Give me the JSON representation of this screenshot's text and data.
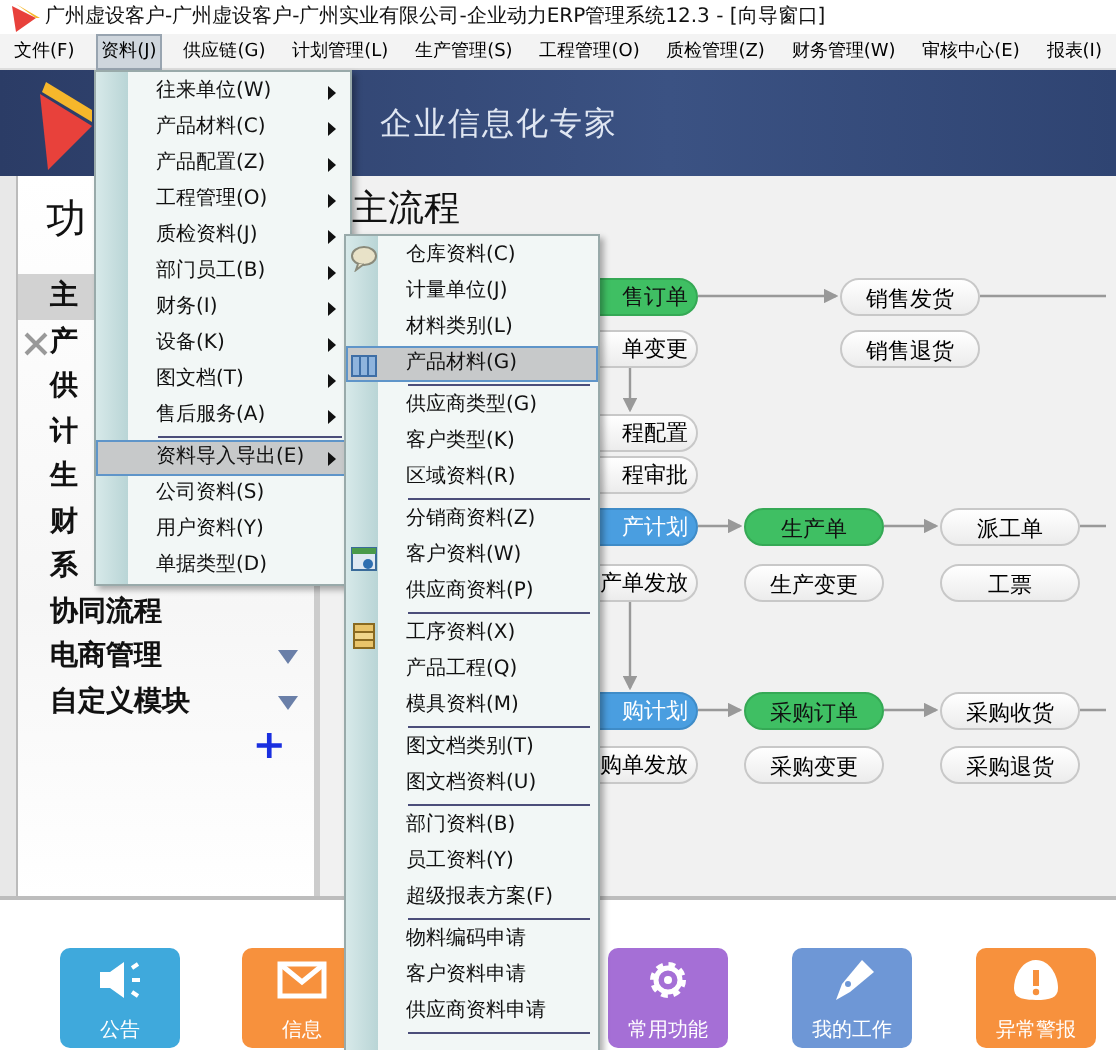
{
  "window": {
    "title": "广州虚设客户-广州虚设客户-广州实业有限公司-企业动力ERP管理系统12.3 - [向导窗口]"
  },
  "menu_bar": [
    {
      "label": "文件(F)",
      "selected": false
    },
    {
      "label": "资料(J)",
      "selected": true
    },
    {
      "label": "供应链(G)",
      "selected": false
    },
    {
      "label": "计划管理(L)",
      "selected": false
    },
    {
      "label": "生产管理(S)",
      "selected": false
    },
    {
      "label": "工程管理(O)",
      "selected": false
    },
    {
      "label": "质检管理(Z)",
      "selected": false
    },
    {
      "label": "财务管理(W)",
      "selected": false
    },
    {
      "label": "审核中心(E)",
      "selected": false
    },
    {
      "label": "报表(I)",
      "selected": false
    }
  ],
  "banner": {
    "slogan": "企业信息化专家"
  },
  "sidebar": {
    "title": "功",
    "items": [
      {
        "label": "主",
        "selected": true,
        "dropdown": false
      },
      {
        "label": "产",
        "selected": false,
        "dropdown": false
      },
      {
        "label": "供",
        "selected": false,
        "dropdown": false
      },
      {
        "label": "计",
        "selected": false,
        "dropdown": false
      },
      {
        "label": "生",
        "selected": false,
        "dropdown": false
      },
      {
        "label": "财",
        "selected": false,
        "dropdown": false
      },
      {
        "label": "系",
        "selected": false,
        "dropdown": false
      },
      {
        "label": "协同流程",
        "selected": false,
        "dropdown": false
      },
      {
        "label": "电商管理",
        "selected": false,
        "dropdown": true
      },
      {
        "label": "自定义模块",
        "selected": false,
        "dropdown": true
      }
    ],
    "add_label": "+"
  },
  "main": {
    "title": "主流程",
    "nodes": [
      {
        "label": "售订单",
        "kind": "highlight"
      },
      {
        "label": "单变更",
        "kind": "normal"
      },
      {
        "label": "销售发货",
        "kind": "normal"
      },
      {
        "label": "销售退货",
        "kind": "normal"
      },
      {
        "label": "程配置",
        "kind": "normal"
      },
      {
        "label": "程审批",
        "kind": "normal"
      },
      {
        "label": "产计划",
        "kind": "plan"
      },
      {
        "label": "生产单",
        "kind": "highlight"
      },
      {
        "label": "派工单",
        "kind": "normal"
      },
      {
        "label": "产单发放",
        "kind": "normal"
      },
      {
        "label": "生产变更",
        "kind": "normal"
      },
      {
        "label": "工票",
        "kind": "normal"
      },
      {
        "label": "购计划",
        "kind": "plan"
      },
      {
        "label": "采购订单",
        "kind": "highlight"
      },
      {
        "label": "采购收货",
        "kind": "normal"
      },
      {
        "label": "购单发放",
        "kind": "normal"
      },
      {
        "label": "采购变更",
        "kind": "normal"
      },
      {
        "label": "采购退货",
        "kind": "normal"
      }
    ]
  },
  "tiles": [
    {
      "label": "公告",
      "color": "#3fa9dc"
    },
    {
      "label": "信息",
      "color": "#f7913d"
    },
    {
      "label": "常用功能",
      "color": "#a56fd6"
    },
    {
      "label": "我的工作",
      "color": "#6e97d6"
    },
    {
      "label": "异常警报",
      "color": "#f7913d"
    }
  ],
  "dropdown": {
    "items": [
      {
        "kind": "item",
        "label": "往来单位(W)",
        "submenu": true,
        "selected": false
      },
      {
        "kind": "item",
        "label": "产品材料(C)",
        "submenu": true,
        "selected": false
      },
      {
        "kind": "item",
        "label": "产品配置(Z)",
        "submenu": true,
        "selected": false
      },
      {
        "kind": "item",
        "label": "工程管理(O)",
        "submenu": true,
        "selected": false
      },
      {
        "kind": "item",
        "label": "质检资料(J)",
        "submenu": true,
        "selected": false
      },
      {
        "kind": "item",
        "label": "部门员工(B)",
        "submenu": true,
        "selected": false
      },
      {
        "kind": "item",
        "label": "财务(I)",
        "submenu": true,
        "selected": false
      },
      {
        "kind": "item",
        "label": "设备(K)",
        "submenu": true,
        "selected": false
      },
      {
        "kind": "item",
        "label": "图文档(T)",
        "submenu": true,
        "selected": false
      },
      {
        "kind": "item",
        "label": "售后服务(A)",
        "submenu": true,
        "selected": false
      },
      {
        "kind": "separator"
      },
      {
        "kind": "item",
        "label": "资料导入导出(E)",
        "submenu": true,
        "selected": true
      },
      {
        "kind": "item",
        "label": "公司资料(S)",
        "submenu": false,
        "selected": false
      },
      {
        "kind": "item",
        "label": "用户资料(Y)",
        "submenu": false,
        "selected": false
      },
      {
        "kind": "item",
        "label": "单据类型(D)",
        "submenu": false,
        "selected": false
      }
    ]
  },
  "submenu": {
    "items": [
      {
        "kind": "item",
        "label": "仓库资料(C)",
        "selected": false
      },
      {
        "kind": "item",
        "label": "计量单位(J)",
        "selected": false
      },
      {
        "kind": "item",
        "label": "材料类别(L)",
        "selected": false
      },
      {
        "kind": "item",
        "label": "产品材料(G)",
        "selected": true
      },
      {
        "kind": "separator"
      },
      {
        "kind": "item",
        "label": "供应商类型(G)",
        "selected": false
      },
      {
        "kind": "item",
        "label": "客户类型(K)",
        "selected": false
      },
      {
        "kind": "item",
        "label": "区域资料(R)",
        "selected": false
      },
      {
        "kind": "separator"
      },
      {
        "kind": "item",
        "label": "分销商资料(Z)",
        "selected": false
      },
      {
        "kind": "item",
        "label": "客户资料(W)",
        "selected": false
      },
      {
        "kind": "item",
        "label": "供应商资料(P)",
        "selected": false
      },
      {
        "kind": "separator"
      },
      {
        "kind": "item",
        "label": "工序资料(X)",
        "selected": false
      },
      {
        "kind": "item",
        "label": "产品工程(Q)",
        "selected": false
      },
      {
        "kind": "item",
        "label": "模具资料(M)",
        "selected": false
      },
      {
        "kind": "separator"
      },
      {
        "kind": "item",
        "label": "图文档类别(T)",
        "selected": false
      },
      {
        "kind": "item",
        "label": "图文档资料(U)",
        "selected": false
      },
      {
        "kind": "separator"
      },
      {
        "kind": "item",
        "label": "部门资料(B)",
        "selected": false
      },
      {
        "kind": "item",
        "label": "员工资料(Y)",
        "selected": false
      },
      {
        "kind": "item",
        "label": "超级报表方案(F)",
        "selected": false
      },
      {
        "kind": "separator"
      },
      {
        "kind": "item",
        "label": "物料编码申请",
        "selected": false
      },
      {
        "kind": "item",
        "label": "客户资料申请",
        "selected": false
      },
      {
        "kind": "item",
        "label": "供应商资料申请",
        "selected": false
      },
      {
        "kind": "separator"
      }
    ]
  }
}
